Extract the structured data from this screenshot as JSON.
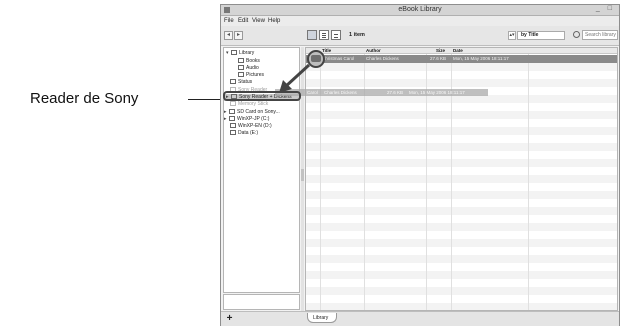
{
  "callout": {
    "label": "Reader de Sony"
  },
  "window": {
    "title": "eBook Library",
    "controls": "_ □"
  },
  "menu": [
    "File",
    "Edit",
    "View",
    "Help"
  ],
  "toolbar": {
    "back": "◂",
    "forward": "▸",
    "items_count": "1 item",
    "sort_arrows": "▴▾",
    "sort_label": "by Title",
    "search_placeholder": "Search library"
  },
  "sidebar": {
    "items": [
      {
        "label": "Library",
        "expander": "▾",
        "indent": 0
      },
      {
        "label": "Books",
        "expander": "",
        "indent": 1
      },
      {
        "label": "Audio",
        "expander": "",
        "indent": 1
      },
      {
        "label": "Pictures",
        "expander": "",
        "indent": 1
      },
      {
        "label": "Status",
        "expander": "",
        "indent": 0
      },
      {
        "label": "Sony Reader",
        "expander": "",
        "indent": 0
      },
      {
        "label": "Sony Reader + Dickens",
        "expander": "▸",
        "indent": 0
      },
      {
        "label": "Memory Stick",
        "expander": "",
        "indent": 0
      },
      {
        "label": "SD Card on Sony...",
        "expander": "▸",
        "indent": 0
      },
      {
        "label": "WinXP-JP (C:)",
        "expander": "▸",
        "indent": 0
      },
      {
        "label": "WinXP-EN (D:)",
        "expander": "",
        "indent": 0
      },
      {
        "label": "Data (E:)",
        "expander": "",
        "indent": 0
      }
    ]
  },
  "table": {
    "columns": [
      "",
      "Title",
      "Author",
      "Size",
      "Date"
    ],
    "rows": [
      {
        "title": "Christmas Carol",
        "author": "Charles Dickens",
        "size": "27.6 KB",
        "date": "Mon, 15 May 2006 18:11:17"
      }
    ]
  },
  "drag_ghost": {
    "title": "Carol",
    "author": "Charles Dickens",
    "size": "27.6 KB",
    "date": "Mon, 15 May 2006 18:11:17"
  },
  "statusbar": {
    "add": "+",
    "tab": "Library"
  }
}
